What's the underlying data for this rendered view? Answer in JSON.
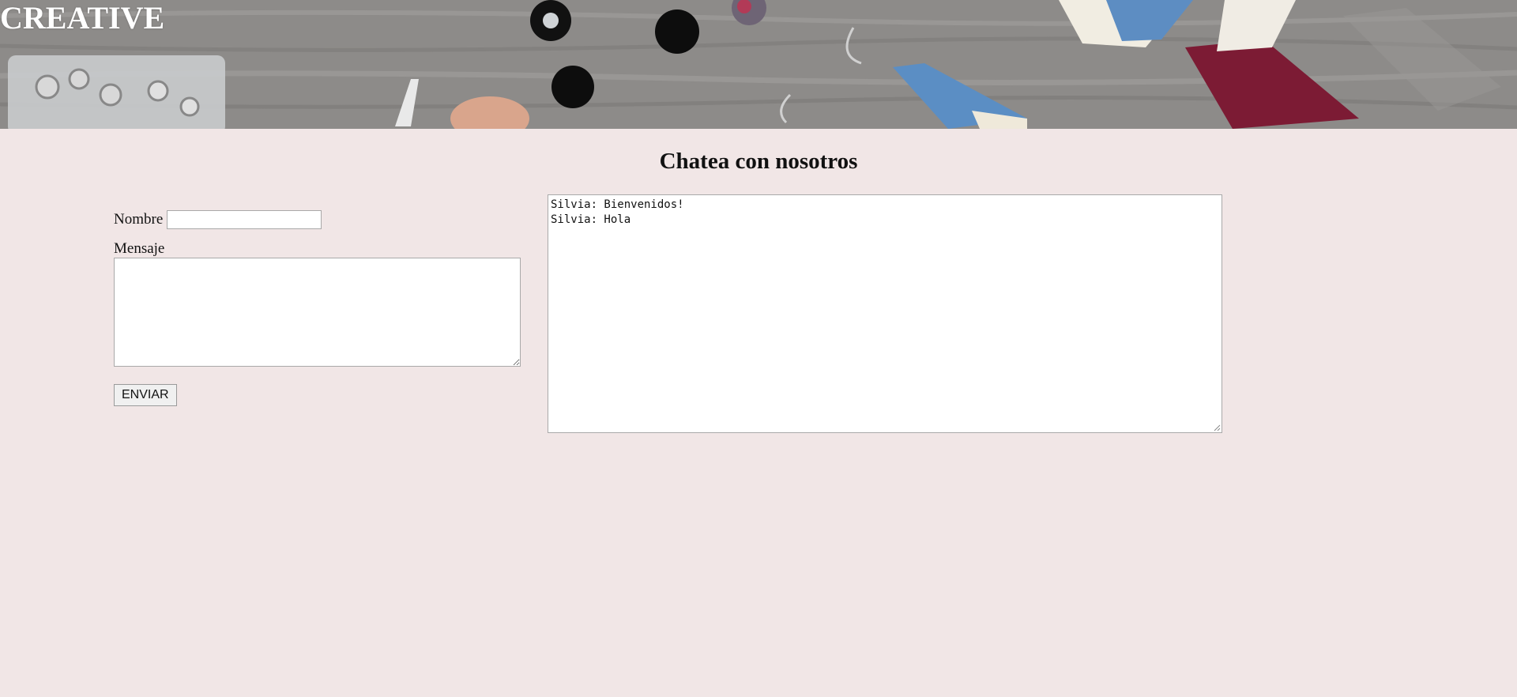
{
  "header": {
    "brand": "CREATIVE"
  },
  "main": {
    "title": "Chatea con nosotros",
    "form": {
      "name_label": "Nombre",
      "name_value": "",
      "name_placeholder": "",
      "message_label": "Mensaje",
      "message_value": "",
      "send_label": "ENVIAR"
    },
    "chat": {
      "lines": [
        "Silvia: Bienvenidos!",
        "Silvia: Hola"
      ]
    }
  },
  "colors": {
    "page_background": "#f1e6e6",
    "banner_tone": "#8f8d8b",
    "brand_text": "#ffffff"
  }
}
